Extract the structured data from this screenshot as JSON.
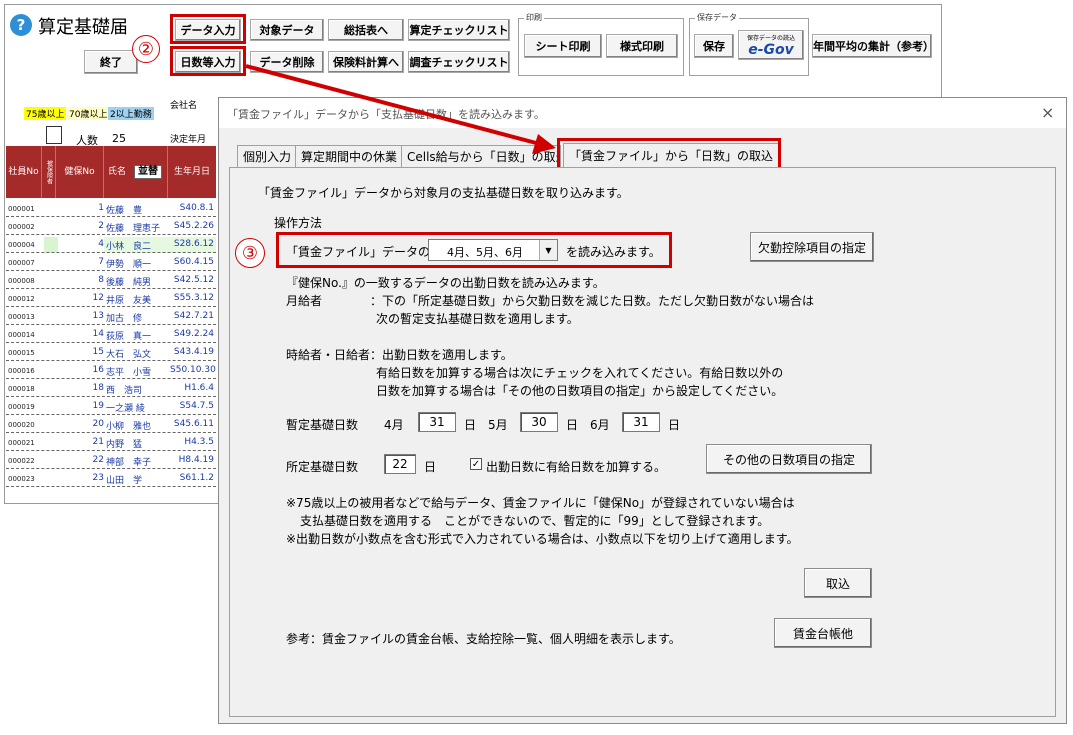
{
  "app": {
    "title": "算定基礎届",
    "help_icon": "?",
    "end_button": "終了",
    "company_label": "会社名",
    "decide_label": "決定年月"
  },
  "toolbar": {
    "row1": [
      "データ入力",
      "対象データ",
      "総括表へ",
      "算定チェックリスト"
    ],
    "row2": [
      "日数等入力",
      "データ削除",
      "保険料計算へ",
      "調査チェックリスト"
    ],
    "print_group": "印刷",
    "sheet_print": "シート印刷",
    "form_print": "様式印刷",
    "save_group": "保存データ",
    "save": "保存",
    "egov_top": "保存データの読込",
    "egov_logo": "e-Gov",
    "annual_avg": "年間平均の集計（参考）"
  },
  "annotations": {
    "circle2": "②",
    "circle3": "③"
  },
  "legend": {
    "over75": "75歳以上",
    "over70": "70歳以上",
    "multi": "2以上勤務"
  },
  "headcount": {
    "label": "人数",
    "value": "25"
  },
  "table": {
    "headers": {
      "emp_no": "社員No",
      "flag": "被保険者",
      "ins_no": "健保No",
      "name": "氏名",
      "sort": "並替",
      "dob": "生年月日"
    },
    "rows": [
      {
        "id": "000001",
        "no": "1",
        "name": "佐藤　豊",
        "dob": "S40.8.1"
      },
      {
        "id": "000002",
        "no": "2",
        "name": "佐藤　理恵子",
        "dob": "S45.2.26"
      },
      {
        "id": "000004",
        "no": "4",
        "name": "小林　良二",
        "dob": "S28.6.12"
      },
      {
        "id": "000007",
        "no": "7",
        "name": "伊勢　順一",
        "dob": "S60.4.15"
      },
      {
        "id": "000008",
        "no": "8",
        "name": "後藤　純男",
        "dob": "S42.5.12"
      },
      {
        "id": "000012",
        "no": "12",
        "name": "井原　友美",
        "dob": "S55.3.12"
      },
      {
        "id": "000013",
        "no": "13",
        "name": "加古　修",
        "dob": "S42.7.21"
      },
      {
        "id": "000014",
        "no": "14",
        "name": "荻原　真一",
        "dob": "S49.2.24"
      },
      {
        "id": "000015",
        "no": "15",
        "name": "大石　弘文",
        "dob": "S43.4.19"
      },
      {
        "id": "000016",
        "no": "16",
        "name": "志平　小雪",
        "dob": "S50.10.30"
      },
      {
        "id": "000018",
        "no": "18",
        "name": "西　浩司",
        "dob": "H1.6.4"
      },
      {
        "id": "000019",
        "no": "19",
        "name": "一之瀬 綾",
        "dob": "S54.7.5"
      },
      {
        "id": "000020",
        "no": "20",
        "name": "小柳　雅也",
        "dob": "S45.6.11"
      },
      {
        "id": "000021",
        "no": "21",
        "name": "内野　猛",
        "dob": "H4.3.5"
      },
      {
        "id": "000022",
        "no": "22",
        "name": "神部　幸子",
        "dob": "H8.4.19"
      },
      {
        "id": "000023",
        "no": "23",
        "name": "山田　学",
        "dob": "S61.1.2"
      }
    ]
  },
  "dialog": {
    "title": "「賃金ファイル」データから「支払基礎日数」を読み込みます。",
    "close": "×",
    "tabs": [
      "個別入力",
      "算定期間中の休業",
      "Cells給与から「日数」の取込",
      "「賃金ファイル」から「日数」の取込"
    ],
    "intro": "「賃金ファイル」データから対象月の支払基礎日数を取り込みます。",
    "method_label": "操作方法",
    "read_prefix": "「賃金ファイル」データの",
    "months_value": "4月、5月、6月",
    "read_suffix": "を読み込みます。",
    "absence_button": "欠勤控除項目の指定",
    "desc1": "『健保No.』の一致するデータの出勤日数を読み込みます。",
    "monthly_label": "月給者",
    "monthly_text1": "：下の「所定基礎日数」から欠勤日数を減じた日数。ただし欠勤日数がない場合は",
    "monthly_text2": "次の暫定支払基礎日数を適用します。",
    "hourly_label": "時給者・日給者：出勤日数を適用します。",
    "hourly_text1": "有給日数を加算する場合は次にチェックを入れてください。有給日数以外の",
    "hourly_text2": "日数を加算する場合は「その他の日数項目の指定」から設定してください。",
    "provisional_label": "暫定基礎日数",
    "m4": "4月",
    "m4_val": "31",
    "m5": "5月",
    "m5_val": "30",
    "m6": "6月",
    "m6_val": "31",
    "day": "日",
    "prescribed_label": "所定基礎日数",
    "prescribed_val": "22",
    "paid_check": "✓",
    "paid_label": "出勤日数に有給日数を加算する。",
    "other_button": "その他の日数項目の指定",
    "note1": "※75歳以上の被用者などで給与データ、賃金ファイルに「健保No」が登録されていない場合は",
    "note2": "支払基礎日数を適用する　ことができないので、暫定的に「99」として登録されます。",
    "note3": "※出勤日数が小数点を含む形式で入力されている場合は、小数点以下を切り上げて適用します。",
    "import_button": "取込",
    "ref_text": "参考：賃金ファイルの賃金台帳、支給控除一覧、個人明細を表示します。",
    "ledger_button": "賃金台帳他"
  },
  "colors": {
    "accent_red": "#d10000",
    "header_brown": "#a52a2a",
    "over75_yellow": "#ffff00",
    "over70_yellow": "#fffec0",
    "multi_blue": "#9ed0f0"
  }
}
